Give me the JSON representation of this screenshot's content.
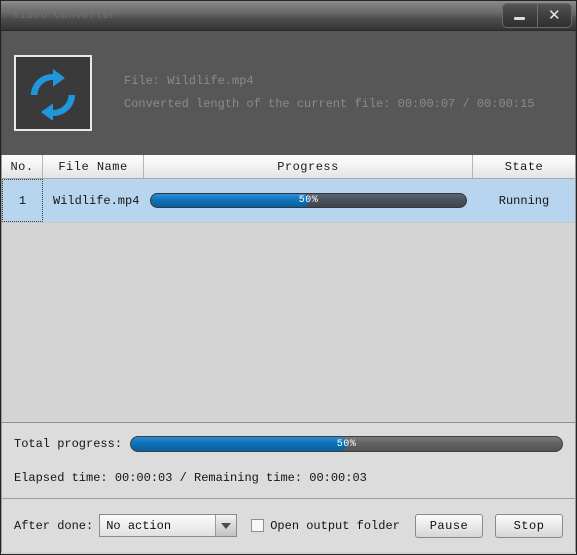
{
  "window": {
    "title": "Video Converter",
    "controls": {
      "minimize_label": "Minimize",
      "close_label": "✕"
    }
  },
  "info_header": {
    "icon": "convert-refresh-icon",
    "file_line": "File: Wildlife.mp4",
    "converted_line": "Converted length of the current file: 00:00:07 / 00:00:15"
  },
  "table": {
    "columns": [
      {
        "key": "no",
        "label": "No."
      },
      {
        "key": "name",
        "label": "File Name"
      },
      {
        "key": "progress",
        "label": "Progress"
      },
      {
        "key": "state",
        "label": "State"
      }
    ],
    "rows": [
      {
        "no": "1",
        "name": "Wildlife.mp4",
        "progress_label": "50%",
        "progress_percent": 50,
        "state": "Running"
      }
    ]
  },
  "status": {
    "total_label": "Total progress:",
    "total_progress_label": "50%",
    "total_progress_percent": 50,
    "time_line": "Elapsed time: 00:00:03 / Remaining time: 00:00:03"
  },
  "actions": {
    "after_done_label": "After done:",
    "after_done_value": "No action",
    "open_output_label": "Open output folder",
    "open_output_checked": false,
    "pause_label": "Pause",
    "stop_label": "Stop"
  },
  "colors": {
    "accent_blue": "#0f72b7",
    "titlebar_dark": "#343434",
    "info_header_bg": "#575757",
    "row_selected_bg": "#b8d5f0",
    "panel_bg": "#dcdcdc",
    "list_bg": "#d4d4d4"
  }
}
